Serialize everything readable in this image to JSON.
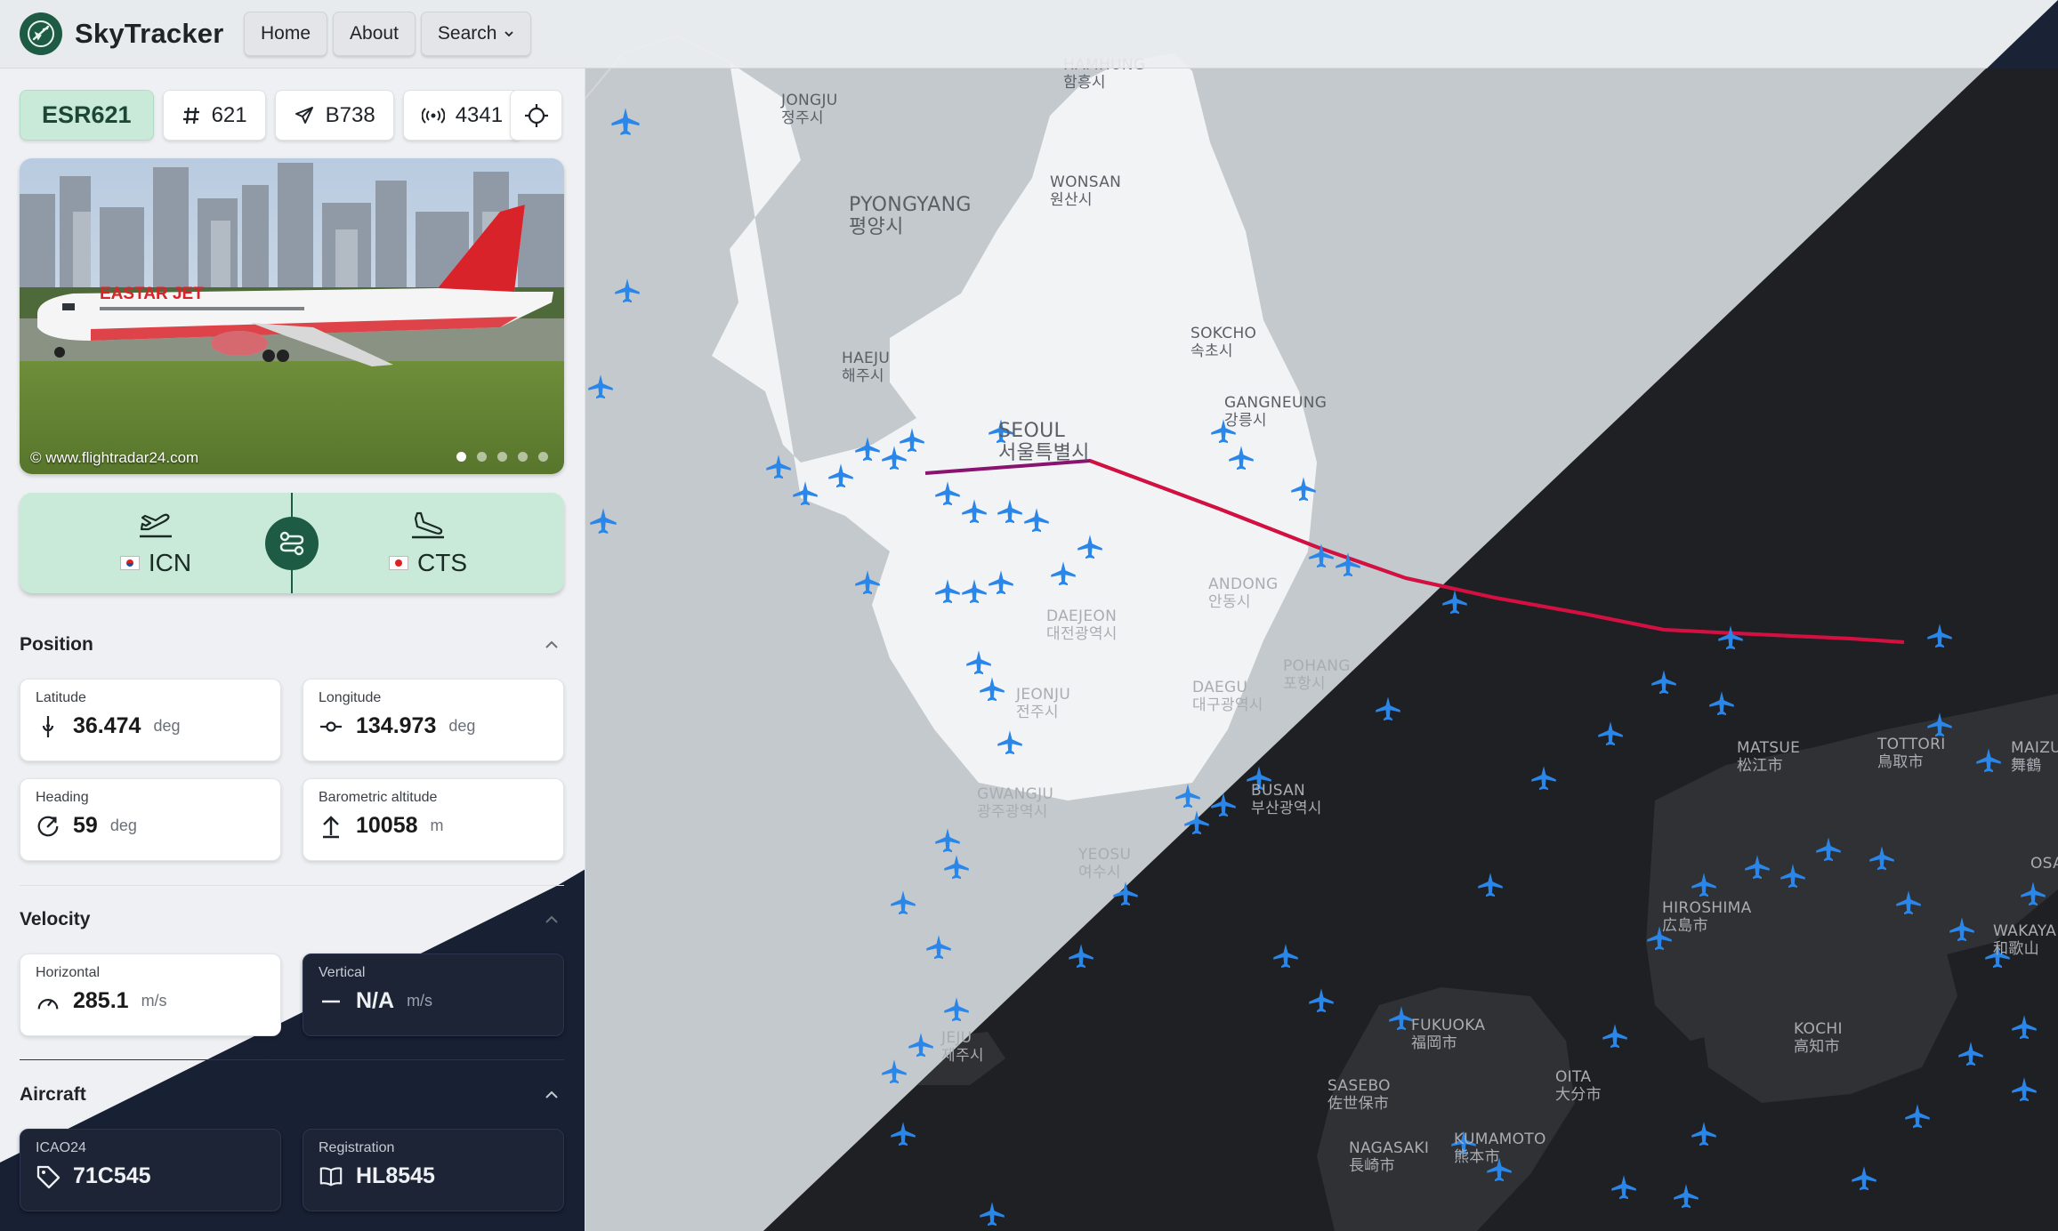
{
  "app": {
    "name": "SkyTracker"
  },
  "nav": {
    "home": "Home",
    "about": "About",
    "search": "Search"
  },
  "flight": {
    "callsign": "ESR621",
    "number": "621",
    "aircraft_type": "B738",
    "squawk": "4341",
    "photo_credit": "© www.flightradar24.com",
    "photo_livery": "EASTAR JET",
    "photo_count": 5,
    "departure": "ICN",
    "arrival": "CTS"
  },
  "position": {
    "title": "Position",
    "latitude_label": "Latitude",
    "latitude": "36.474",
    "latitude_unit": "deg",
    "longitude_label": "Longitude",
    "longitude": "134.973",
    "longitude_unit": "deg",
    "heading_label": "Heading",
    "heading": "59",
    "heading_unit": "deg",
    "altitude_label": "Barometric altitude",
    "altitude": "10058",
    "altitude_unit": "m"
  },
  "velocity": {
    "title": "Velocity",
    "horizontal_label": "Horizontal",
    "horizontal": "285.1",
    "horizontal_unit": "m/s",
    "vertical_label": "Vertical",
    "vertical": "N/A",
    "vertical_unit": "m/s"
  },
  "aircraft": {
    "title": "Aircraft",
    "icao24_label": "ICAO24",
    "icao24": "71C545",
    "registration_label": "Registration",
    "registration": "HL8545"
  },
  "map_labels": {
    "hamhung": "HAMHUNG",
    "hamhung_ko": "함흥시",
    "jongju": "JONGJU",
    "jongju_ko": "정주시",
    "pyongyang": "PYONGYANG",
    "pyongyang_ko": "평양시",
    "wonsan": "WONSAN",
    "wonsan_ko": "원산시",
    "sokcho": "SOKCHO",
    "sokcho_ko": "속초시",
    "haeju": "HAEJU",
    "haeju_ko": "해주시",
    "gangneung": "GANGNEUNG",
    "gangneung_ko": "강릉시",
    "seoul": "SEOUL",
    "seoul_ko": "서울특별시",
    "andong": "ANDONG",
    "andong_ko": "안동시",
    "daejeon": "DAEJEON",
    "daejeon_ko": "대전광역시",
    "pohang": "POHANG",
    "pohang_ko": "포항시",
    "jeonju": "JEONJU",
    "jeonju_ko": "전주시",
    "daegu": "DAEGU",
    "daegu_ko": "대구광역시",
    "gwangju": "GWANGJU",
    "gwangju_ko": "광주광역시",
    "busan": "BUSAN",
    "busan_ko": "부산광역시",
    "yeosu": "YEOSU",
    "yeosu_ko": "여수시",
    "jeju": "JEJU",
    "jeju_ko": "제주시",
    "matsue": "MATSUE",
    "matsue_ko": "松江市",
    "tottori": "TOTTORI",
    "tottori_ko": "鳥取市",
    "maizuru": "MAIZU",
    "maizuru_ko": "舞鶴",
    "hiroshima": "HIROSHIMA",
    "hiroshima_ko": "広島市",
    "osaka": "OSA",
    "wakayama": "WAKAYA",
    "wakayama_ko": "和歌山",
    "fukuoka": "FUKUOKA",
    "fukuoka_ko": "福岡市",
    "kochi": "KOCHI",
    "kochi_ko": "高知市",
    "sasebo": "SASEBO",
    "sasebo_ko": "佐世保市",
    "oita": "OITA",
    "oita_ko": "大分市",
    "nagasaki": "NAGASAKI",
    "nagasaki_ko": "長崎市",
    "kumamoto": "KUMAMOTO",
    "kumamoto_ko": "熊本市"
  },
  "colors": {
    "brand": "#1e5b45",
    "route_bg": "#c9ead9",
    "track_past": "#8a1270",
    "track_recent": "#d3103f",
    "aircraft_icon": "#2a86e8",
    "map_light": "#c2c8cc",
    "map_dark": "#202226"
  }
}
